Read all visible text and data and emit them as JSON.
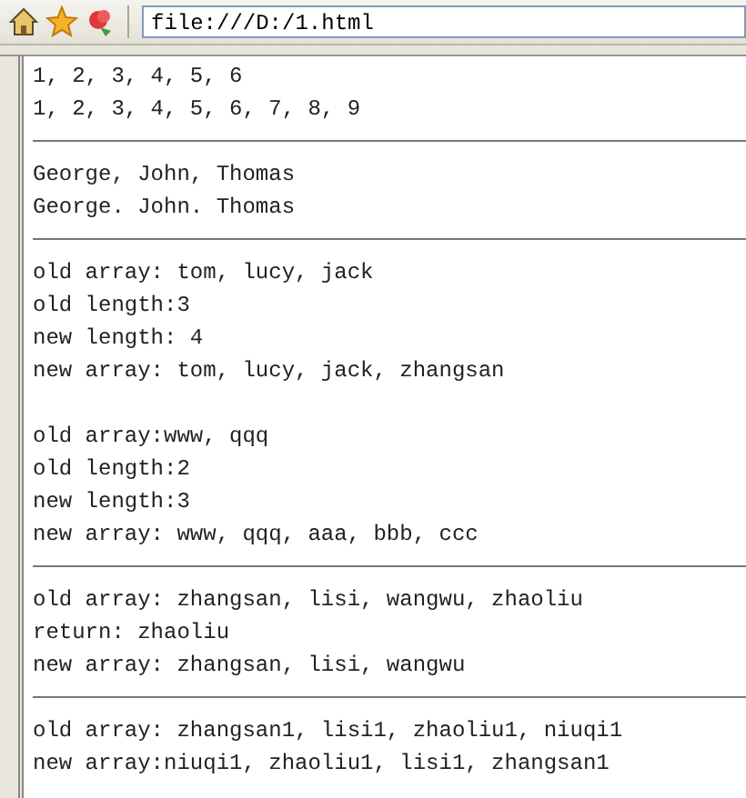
{
  "toolbar": {
    "address": "file:///D:/1.html"
  },
  "sections": [
    {
      "blocks": [
        {
          "lines": [
            "1, 2, 3, 4, 5, 6",
            "1, 2, 3, 4, 5, 6, 7, 8, 9"
          ]
        }
      ]
    },
    {
      "blocks": [
        {
          "lines": [
            "George, John, Thomas",
            "George. John. Thomas"
          ]
        }
      ]
    },
    {
      "blocks": [
        {
          "lines": [
            "old array: tom, lucy, jack",
            "old length:3",
            "new length: 4",
            "new array: tom, lucy, jack, zhangsan"
          ]
        },
        {
          "lines": [
            "old array:www, qqq",
            "old length:2",
            "new length:3",
            "new array: www, qqq, aaa, bbb, ccc"
          ]
        }
      ]
    },
    {
      "blocks": [
        {
          "lines": [
            "old array: zhangsan, lisi, wangwu, zhaoliu",
            "return: zhaoliu",
            "new array: zhangsan, lisi, wangwu"
          ]
        }
      ]
    },
    {
      "blocks": [
        {
          "lines": [
            "old array: zhangsan1, lisi1, zhaoliu1, niuqi1",
            "new array:niuqi1, zhaoliu1, lisi1, zhangsan1"
          ]
        }
      ]
    }
  ]
}
